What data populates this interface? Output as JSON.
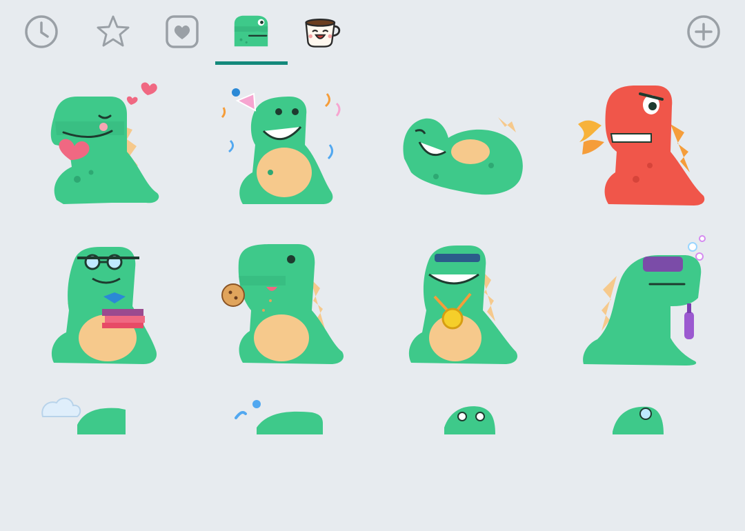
{
  "tabs": [
    {
      "name": "recent",
      "icon": "clock-icon",
      "selected": false
    },
    {
      "name": "favorites",
      "icon": "star-icon",
      "selected": false
    },
    {
      "name": "liked",
      "icon": "heart-icon",
      "selected": false
    },
    {
      "name": "dino-pack",
      "icon": "dinosaur-pack-icon",
      "selected": true
    },
    {
      "name": "coffee-pack",
      "icon": "coffee-cup-pack-icon",
      "selected": false
    },
    {
      "name": "add",
      "icon": "plus-icon",
      "selected": false
    }
  ],
  "colors": {
    "background": "#e7ebef",
    "accent": "#14897b",
    "icon_gray": "#9aa0a6",
    "dino_green": "#3ec98a",
    "dino_belly": "#f6c98c",
    "dino_red": "#f0564a"
  },
  "stickers": [
    {
      "name": "dino-love-heart"
    },
    {
      "name": "dino-party-hat"
    },
    {
      "name": "dino-laughing-on-back"
    },
    {
      "name": "dino-angry-red-fire"
    },
    {
      "name": "dino-nerd-glasses-books"
    },
    {
      "name": "dino-eating-cookie"
    },
    {
      "name": "dino-sunglasses-medal"
    },
    {
      "name": "dino-cool-bottle"
    },
    {
      "name": "dino-chef-partial"
    },
    {
      "name": "dino-splash-partial"
    },
    {
      "name": "dino-peeking-partial"
    },
    {
      "name": "dino-glasses-partial"
    }
  ]
}
